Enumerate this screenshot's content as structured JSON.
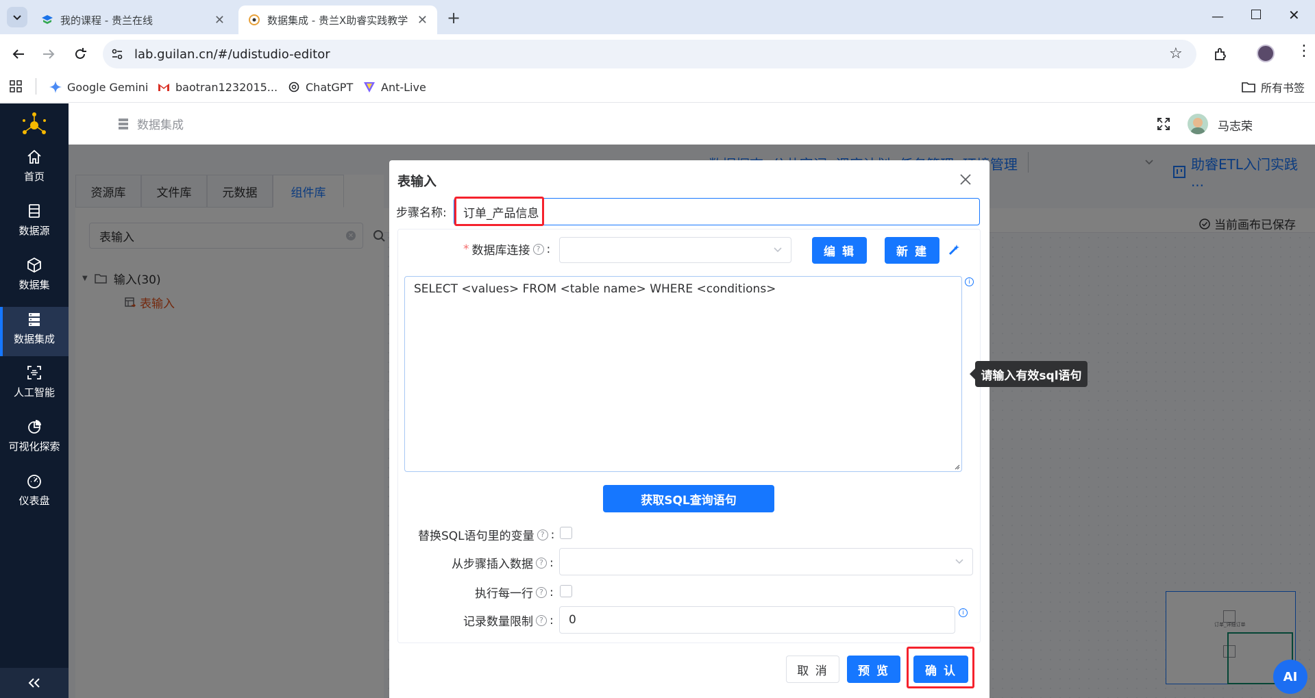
{
  "browser": {
    "tabs": [
      {
        "title": "我的课程 - 贵兰在线"
      },
      {
        "title": "数据集成 - 贵兰X助睿实践教学"
      }
    ],
    "url": "lab.guilan.cn/#/udistudio-editor",
    "bookmarks": [
      "Google Gemini",
      "baotran1232015...",
      "ChatGPT",
      "Ant-Live"
    ],
    "all_bookmarks": "所有书签"
  },
  "sidebar": {
    "items": [
      {
        "label": "首页",
        "icon": "home-icon"
      },
      {
        "label": "数据源",
        "icon": "database-icon"
      },
      {
        "label": "数据集",
        "icon": "cube-icon"
      },
      {
        "label": "数据集成",
        "icon": "server-icon"
      },
      {
        "label": "人工智能",
        "icon": "ai-scan-icon"
      },
      {
        "label": "可视化探索",
        "icon": "pie-chart-icon"
      },
      {
        "label": "仪表盘",
        "icon": "dashboard-icon"
      }
    ],
    "active_index": 3
  },
  "topbar": {
    "breadcrumb": "数据集成",
    "user_name": "马志荣"
  },
  "background": {
    "menu": "数据探查  公共字词  调度计划  任务管理  环境管理",
    "project": "助睿ETL入门实践 ...",
    "saved_status": "当前画布已保存",
    "tabs": [
      "资源库",
      "文件库",
      "元数据",
      "组件库"
    ],
    "active_tab": 3,
    "search_value": "表输入",
    "tree_folder": "输入(30)",
    "tree_leaf": "表输入",
    "minimap_label": "订单_详细订单"
  },
  "dialog": {
    "title": "表输入",
    "step_name_label": "步骤名称:",
    "step_name_value": "订单_产品信息",
    "db_conn_label": "数据库连接",
    "edit_btn": "编 辑",
    "new_btn": "新 建",
    "sql_text": "SELECT <values> FROM <table name> WHERE <conditions>",
    "tooltip": "请输入有效sql语句",
    "get_sql_btn": "获取SQL查询语句",
    "replace_vars_label": "替换SQL语句里的变量",
    "insert_from_step_label": "从步骤插入数据",
    "exec_each_row_label": "执行每一行",
    "record_limit_label": "记录数量限制",
    "record_limit_value": "0",
    "cancel_btn": "取 消",
    "preview_btn": "预 览",
    "confirm_btn": "确 认"
  },
  "ai_badge": "AI",
  "colors": {
    "primary": "#1677ff",
    "sidebar_bg": "#0f1b2e",
    "highlight": "#f5222d"
  }
}
